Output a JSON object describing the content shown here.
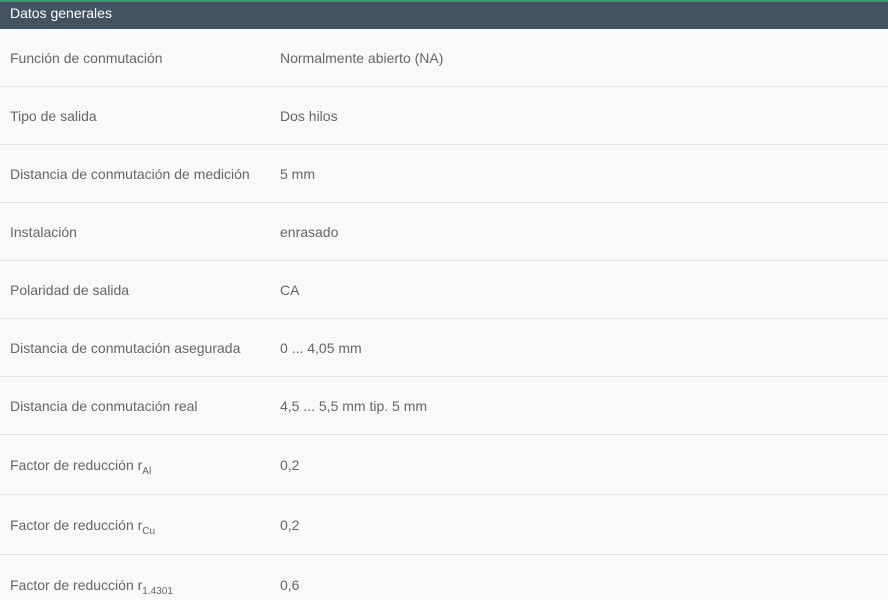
{
  "header": {
    "title": "Datos generales"
  },
  "rows": [
    {
      "label": "Función de conmutación",
      "value": "Normalmente abierto (NA)"
    },
    {
      "label": "Tipo de salida",
      "value": "Dos hilos"
    },
    {
      "label": "Distancia de conmutación de medición",
      "value": "5 mm"
    },
    {
      "label": "Instalación",
      "value": "enrasado"
    },
    {
      "label": "Polaridad de salida",
      "value": "CA"
    },
    {
      "label": "Distancia de conmutación asegurada",
      "value": "0 ... 4,05 mm"
    },
    {
      "label": "Distancia de conmutación real",
      "value": "4,5 ... 5,5 mm tip. 5 mm"
    },
    {
      "label": "Factor de reducción r",
      "sub": "Al",
      "value": "0,2"
    },
    {
      "label": "Factor de reducción r",
      "sub": "Cu",
      "value": "0,2"
    },
    {
      "label": "Factor de reducción r",
      "sub": "1.4301",
      "value": "0,6"
    }
  ]
}
